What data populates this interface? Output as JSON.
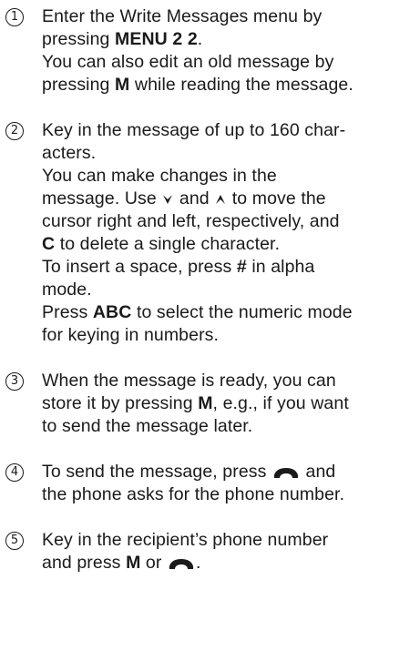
{
  "steps": [
    {
      "num": "1",
      "l1": "Enter the Write Messages menu by",
      "l2_pre": "pressing ",
      "l2_key": "MENU 2 2",
      "l2_post": ".",
      "l3": "You can also edit an old message by",
      "l4_pre": "pressing ",
      "l4_key": "M",
      "l4_post": " while reading the message."
    },
    {
      "num": "2",
      "l1": "Key in the message of up to 160 char-",
      "l2": "acters.",
      "l3": "You can make changes in the",
      "l4_pre": "message. Use ",
      "l4_mid": " and ",
      "l4_post": " to move the",
      "l5": "cursor right and left, respectively, and",
      "l6_key": "C",
      "l6_post": " to delete a single character.",
      "l7_pre": "To insert a space, press ",
      "l7_key": "#",
      "l7_post": " in alpha",
      "l8": "mode.",
      "l9_pre": "Press ",
      "l9_key": "ABC",
      "l9_post": " to select the numeric mode",
      "l10": "for keying in numbers."
    },
    {
      "num": "3",
      "l1": "When the message is ready, you can",
      "l2_pre": "store it by pressing ",
      "l2_key": "M",
      "l2_post": ", e.g., if you want",
      "l3": "to send the message later."
    },
    {
      "num": "4",
      "l1_pre": "To send the message, press ",
      "l1_post": " and",
      "l2": "the phone asks for the phone number."
    },
    {
      "num": "5",
      "l1": "Key in the recipient’s phone number",
      "l2_pre": "and press ",
      "l2_key": "M",
      "l2_mid": " or ",
      "l2_post": "."
    }
  ],
  "icons": {
    "down": "chevron-down-icon",
    "up": "chevron-up-icon",
    "call": "call-key-icon"
  }
}
